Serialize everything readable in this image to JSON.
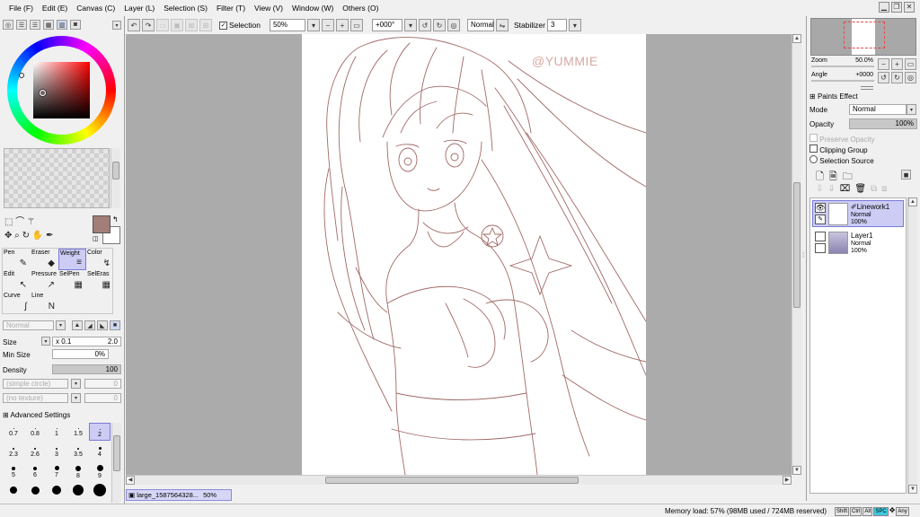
{
  "menu": [
    "File (F)",
    "Edit (E)",
    "Canvas (C)",
    "Layer (L)",
    "Selection (S)",
    "Filter (T)",
    "View (V)",
    "Window (W)",
    "Others (O)"
  ],
  "window_controls": {
    "minimize": "▁",
    "restore": "❐",
    "close": "✕"
  },
  "toolbar": {
    "selection_label": "Selection",
    "zoom_value": "50%",
    "angle_value": "+000°",
    "blend_mode": "Normal",
    "stabilizer_label": "Stabilizer",
    "stabilizer_value": "3"
  },
  "colors": {
    "primary": "#a37d78",
    "secondary": "#ffffff",
    "selection": "#ccccf5",
    "canvas_bg": "#ababab",
    "lineart": "#a06a66"
  },
  "tools": [
    {
      "name": "Pen",
      "icon": "pen-icon",
      "glyph": "✎"
    },
    {
      "name": "Eraser",
      "icon": "eraser-icon",
      "glyph": "◆"
    },
    {
      "name": "Weight",
      "icon": "weight-icon",
      "glyph": "≡"
    },
    {
      "name": "Color",
      "icon": "color-pick-icon",
      "glyph": "↯"
    },
    {
      "name": "Edit",
      "icon": "edit-icon",
      "glyph": "↖"
    },
    {
      "name": "Pressure",
      "icon": "pressure-icon",
      "glyph": "↗"
    },
    {
      "name": "SelPen",
      "icon": "selpen-icon",
      "glyph": "▦"
    },
    {
      "name": "SelEras",
      "icon": "seleras-icon",
      "glyph": "▦"
    },
    {
      "name": "Curve",
      "icon": "curve-icon",
      "glyph": "∫"
    },
    {
      "name": "Line",
      "icon": "line-icon",
      "glyph": "N"
    }
  ],
  "brush": {
    "blend": "Normal",
    "size_label": "Size",
    "size_mult": "x 0.1",
    "size_value": "2.0",
    "minsize_label": "Min Size",
    "minsize_value": "0%",
    "density_label": "Density",
    "density_value": "100",
    "shape": "(simple circle)",
    "shape_value": "0",
    "texture": "(no texture)",
    "texture_value": "0",
    "advanced_label": "Advanced Settings"
  },
  "brush_sizes": [
    {
      "label": "0.7",
      "d": 1
    },
    {
      "label": "0.8",
      "d": 1
    },
    {
      "label": "1",
      "d": 1
    },
    {
      "label": "1.5",
      "d": 1
    },
    {
      "label": "2",
      "d": 1
    },
    {
      "label": "2.3",
      "d": 2
    },
    {
      "label": "2.6",
      "d": 2
    },
    {
      "label": "3",
      "d": 2
    },
    {
      "label": "3.5",
      "d": 2
    },
    {
      "label": "4",
      "d": 3
    },
    {
      "label": "5",
      "d": 4
    },
    {
      "label": "6",
      "d": 4
    },
    {
      "label": "7",
      "d": 5
    },
    {
      "label": "8",
      "d": 6
    },
    {
      "label": "9",
      "d": 7
    },
    {
      "label": "",
      "d": 8
    },
    {
      "label": "",
      "d": 9
    },
    {
      "label": "",
      "d": 10
    },
    {
      "label": "",
      "d": 12
    },
    {
      "label": "",
      "d": 14
    }
  ],
  "navigator": {
    "zoom_label": "Zoom",
    "zoom_value": "50.0%",
    "angle_label": "Angle",
    "angle_value": "+0000"
  },
  "layer_panel": {
    "paints_effect": "Paints Effect",
    "mode_label": "Mode",
    "mode_value": "Normal",
    "opacity_label": "Opacity",
    "opacity_value": "100%",
    "preserve_opacity": "Preserve Opacity",
    "clipping_group": "Clipping Group",
    "selection_source": "Selection Source"
  },
  "layers": [
    {
      "name": "Linework1",
      "mode": "Normal",
      "opacity": "100%"
    },
    {
      "name": "Layer1",
      "mode": "Normal",
      "opacity": "100%"
    }
  ],
  "canvas": {
    "watermark": "@YUMMIE"
  },
  "document_tab": {
    "name": "large_1587564328...",
    "zoom": "50%"
  },
  "status": {
    "memory": "Memory load: 57% (98MB used / 724MB reserved)",
    "keys": [
      "Shift",
      "Ctrl",
      "Alt",
      "SPC",
      "Any"
    ]
  }
}
